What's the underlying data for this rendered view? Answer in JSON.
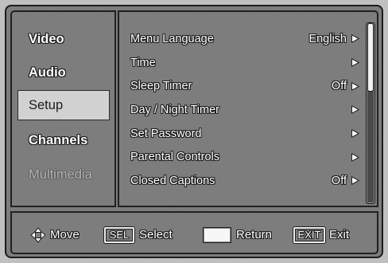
{
  "colors": {
    "text": "#ffffff",
    "text_outline": "#1d1d1d",
    "selected_text": "#1b1b1b",
    "disabled_text": "#b4b4b4"
  },
  "sidebar": {
    "items": [
      {
        "label": "Video",
        "state": "normal"
      },
      {
        "label": "Audio",
        "state": "normal"
      },
      {
        "label": "Setup",
        "state": "selected"
      },
      {
        "label": "Channels",
        "state": "normal"
      },
      {
        "label": "Multimedia",
        "state": "disabled"
      }
    ]
  },
  "menu": {
    "arrow_icon": "right-arrow-icon",
    "items": [
      {
        "label": "Menu Language",
        "value": "English"
      },
      {
        "label": "Time"
      },
      {
        "label": "Sleep Timer",
        "value": "Off"
      },
      {
        "label": "Day / Night Timer"
      },
      {
        "label": "Set Password"
      },
      {
        "label": "Parental Controls"
      },
      {
        "label": "Closed Captions",
        "value": "Off"
      }
    ]
  },
  "scrollbar": {
    "thumb_fraction": 0.38,
    "scroll_offset": 0
  },
  "footer": {
    "move": {
      "icon": "four-way-arrow-icon",
      "label": "Move"
    },
    "select": {
      "key": "SEL",
      "label": "Select"
    },
    "return": {
      "icon": "return-key-icon",
      "label": "Return"
    },
    "exit": {
      "key": "EXIT",
      "label": "Exit"
    }
  }
}
